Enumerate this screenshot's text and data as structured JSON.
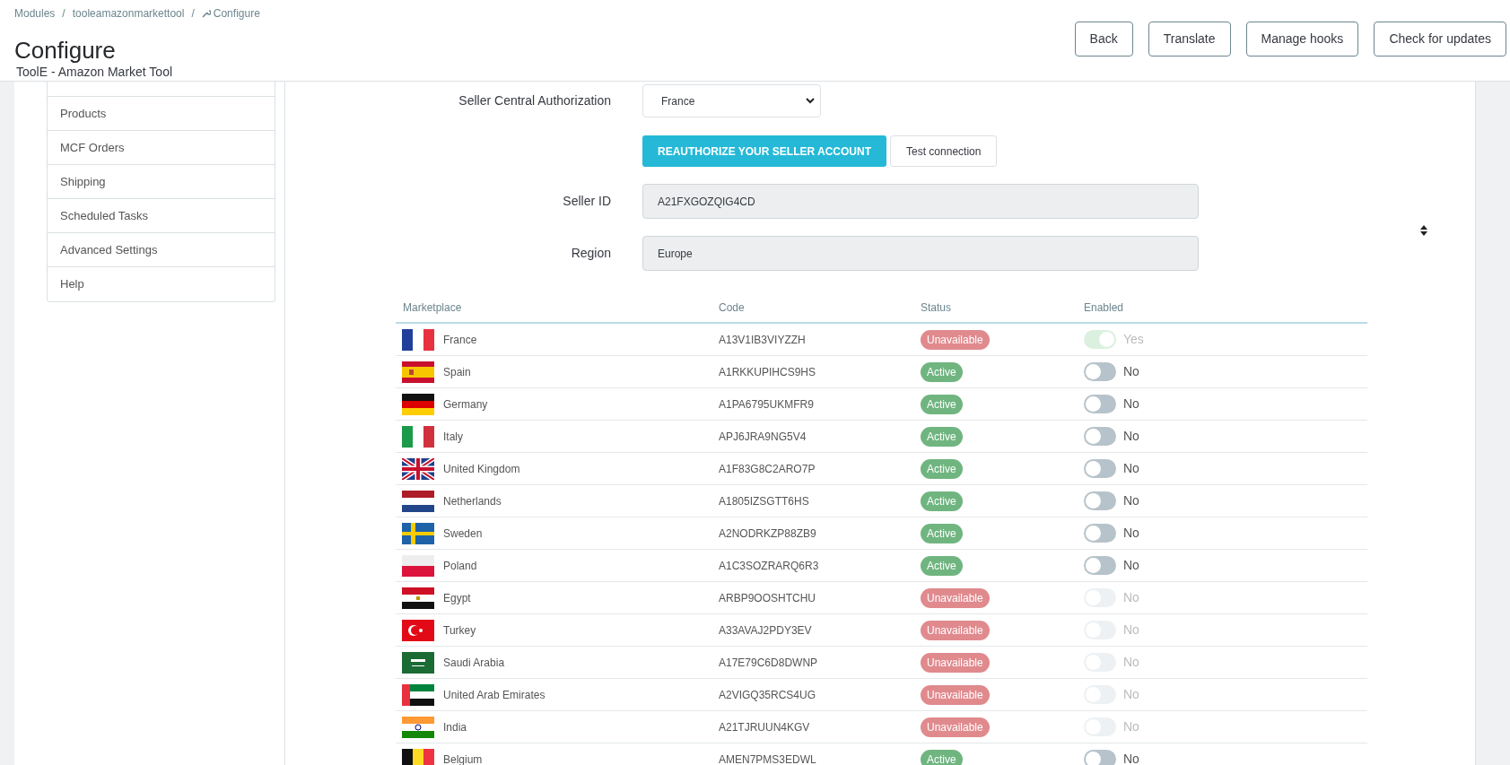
{
  "breadcrumb": [
    {
      "label": "Modules",
      "kind": "link"
    },
    {
      "label": "tooleamazonmarkettool",
      "kind": "link"
    },
    {
      "label": "Configure",
      "kind": "current"
    }
  ],
  "breadcrumb_separator": "/",
  "page": {
    "title": "Configure",
    "subtitle": "ToolE - Amazon Market Tool"
  },
  "toolbar": [
    "Back",
    "Translate",
    "Manage hooks",
    "Check for updates"
  ],
  "sidebar": {
    "items": [
      {
        "label": "Products"
      },
      {
        "label": "MCF Orders"
      },
      {
        "label": "Shipping"
      },
      {
        "label": "Scheduled Tasks"
      },
      {
        "label": "Advanced Settings"
      },
      {
        "label": "Help"
      }
    ]
  },
  "form": {
    "authorization": {
      "label": "Seller Central Authorization",
      "value": "France"
    },
    "buttons": [
      {
        "label": "REAUTHORIZE YOUR SELLER ACCOUNT",
        "kind": "primary"
      },
      {
        "label": "Test connection",
        "kind": "default"
      }
    ],
    "seller_id": {
      "label": "Seller ID",
      "value": "A21FXGOZQIG4CD"
    },
    "region": {
      "label": "Region",
      "value": "Europe"
    }
  },
  "table": {
    "columns": [
      "Marketplace",
      "Code",
      "Status",
      "Enabled"
    ],
    "rows": [
      {
        "marketplace": "France",
        "code": "A13V1IB3VIYZZH",
        "status": "Unavailable",
        "kind": "unavailable",
        "enabled": true,
        "disabled": true,
        "toggle_label": "Yes"
      },
      {
        "marketplace": "Spain",
        "code": "A1RKKUPIHCS9HS",
        "status": "Active",
        "kind": "active",
        "enabled": false,
        "disabled": false,
        "toggle_label": "No"
      },
      {
        "marketplace": "Germany",
        "code": "A1PA6795UKMFR9",
        "status": "Active",
        "kind": "active",
        "enabled": false,
        "disabled": false,
        "toggle_label": "No"
      },
      {
        "marketplace": "Italy",
        "code": "APJ6JRA9NG5V4",
        "status": "Active",
        "kind": "active",
        "enabled": false,
        "disabled": false,
        "toggle_label": "No"
      },
      {
        "marketplace": "United Kingdom",
        "code": "A1F83G8C2ARO7P",
        "status": "Active",
        "kind": "active",
        "enabled": false,
        "disabled": false,
        "toggle_label": "No"
      },
      {
        "marketplace": "Netherlands",
        "code": "A1805IZSGTT6HS",
        "status": "Active",
        "kind": "active",
        "enabled": false,
        "disabled": false,
        "toggle_label": "No"
      },
      {
        "marketplace": "Sweden",
        "code": "A2NODRKZP88ZB9",
        "status": "Active",
        "kind": "active",
        "enabled": false,
        "disabled": false,
        "toggle_label": "No"
      },
      {
        "marketplace": "Poland",
        "code": "A1C3SOZRARQ6R3",
        "status": "Active",
        "kind": "active",
        "enabled": false,
        "disabled": false,
        "toggle_label": "No"
      },
      {
        "marketplace": "Egypt",
        "code": "ARBP9OOSHTCHU",
        "status": "Unavailable",
        "kind": "unavailable",
        "enabled": false,
        "disabled": true,
        "toggle_label": "No"
      },
      {
        "marketplace": "Turkey",
        "code": "A33AVAJ2PDY3EV",
        "status": "Unavailable",
        "kind": "unavailable",
        "enabled": false,
        "disabled": true,
        "toggle_label": "No"
      },
      {
        "marketplace": "Saudi Arabia",
        "code": "A17E79C6D8DWNP",
        "status": "Unavailable",
        "kind": "unavailable",
        "enabled": false,
        "disabled": true,
        "toggle_label": "No"
      },
      {
        "marketplace": "United Arab Emirates",
        "code": "A2VIGQ35RCS4UG",
        "status": "Unavailable",
        "kind": "unavailable",
        "enabled": false,
        "disabled": true,
        "toggle_label": "No"
      },
      {
        "marketplace": "India",
        "code": "A21TJRUUN4KGV",
        "status": "Unavailable",
        "kind": "unavailable",
        "enabled": false,
        "disabled": true,
        "toggle_label": "No"
      },
      {
        "marketplace": "Belgium",
        "code": "AMEN7PMS3EDWL",
        "status": "Active",
        "kind": "active",
        "enabled": false,
        "disabled": false,
        "toggle_label": "No"
      }
    ]
  }
}
